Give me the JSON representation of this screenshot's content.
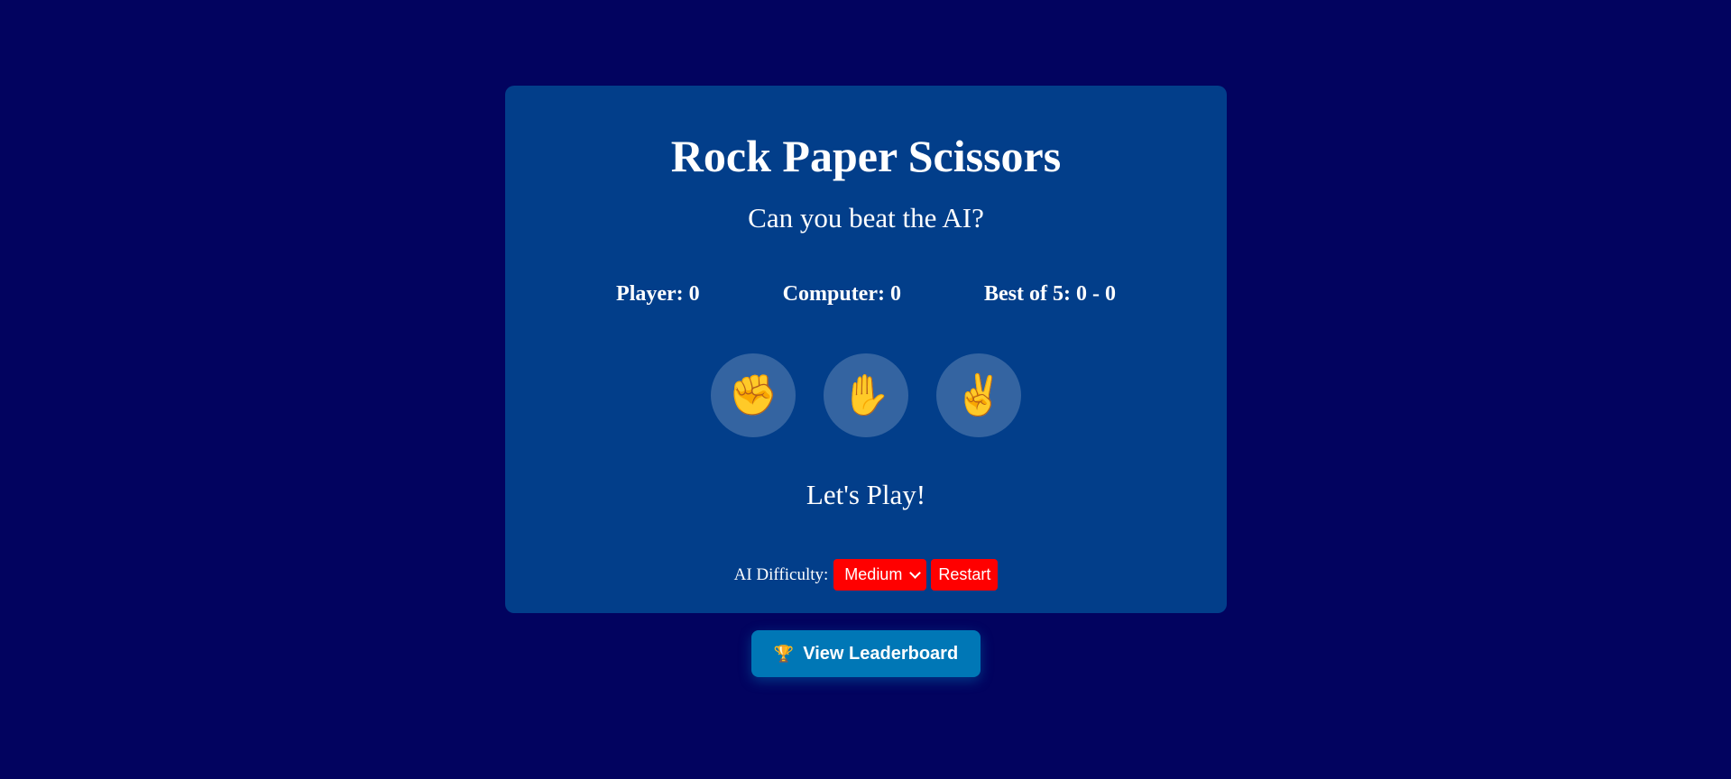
{
  "game": {
    "title": "Rock Paper Scissors",
    "subtitle": "Can you beat the AI?",
    "scores": {
      "player": "Player: 0",
      "computer": "Computer: 0",
      "best_of": "Best of 5: 0 - 0"
    },
    "choices": [
      {
        "name": "rock",
        "glyph": "✊"
      },
      {
        "name": "paper",
        "glyph": "✋"
      },
      {
        "name": "scissors",
        "glyph": "✌️"
      }
    ],
    "status": "Let's Play!",
    "controls": {
      "difficulty_label": "AI Difficulty:",
      "difficulty_value": "Medium",
      "restart_label": "Restart"
    }
  },
  "leaderboard": {
    "icon": "🏆",
    "label": "View Leaderboard"
  },
  "colors": {
    "background": "#02035f",
    "card": "#023e8a",
    "control_red": "#ff0000",
    "leaderboard_blue": "#0077b6"
  }
}
